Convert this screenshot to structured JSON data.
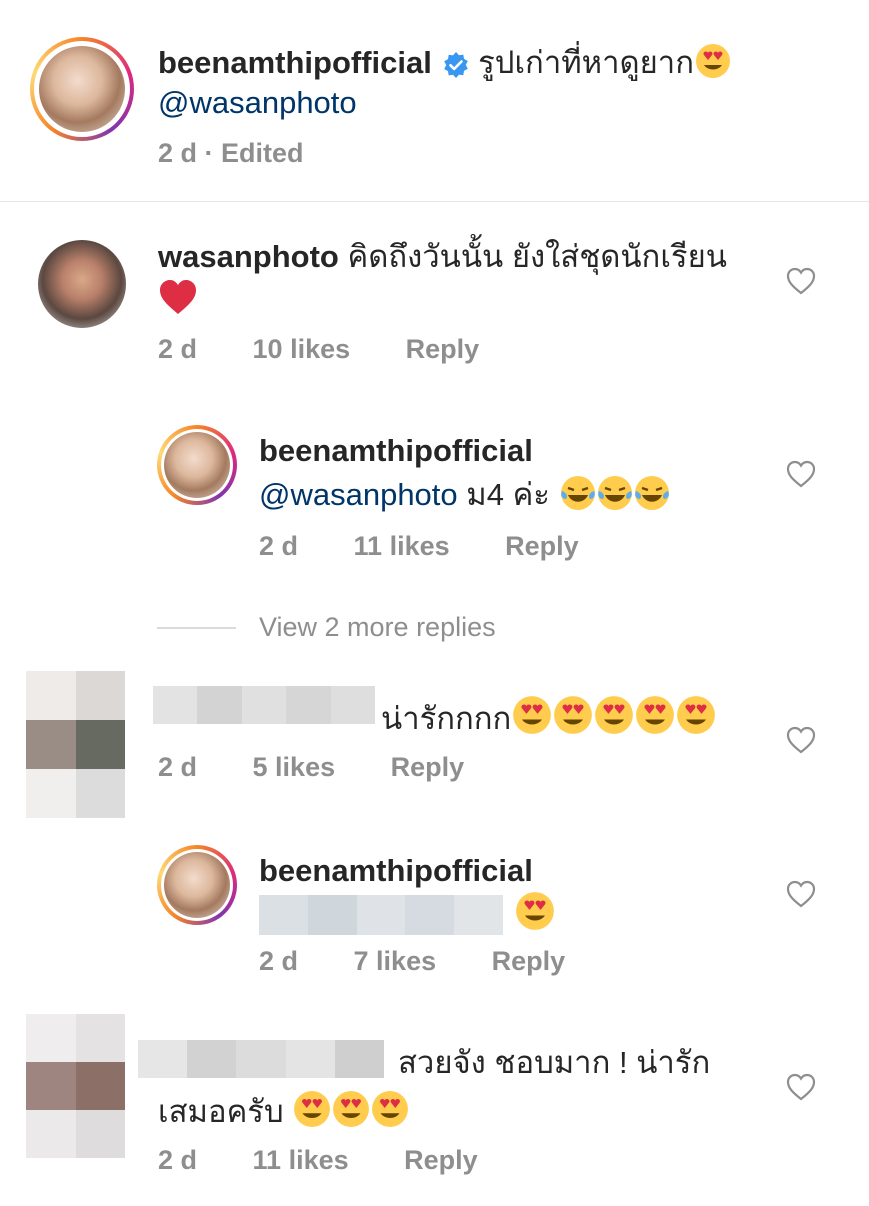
{
  "post": {
    "username": "beenamthipofficial",
    "caption": "รูปเก่าที่หาดูยาก",
    "mention": "@wasanphoto",
    "time": "2 d",
    "edited": "Edited"
  },
  "comments": [
    {
      "username": "wasanphoto",
      "text_line1": "คิดถึงวันนั้น ยังใส่ชุดนักเรียน",
      "time": "2 d",
      "likes": "10 likes",
      "reply": "Reply"
    },
    {
      "username": "beenamthipofficial",
      "mention": "@wasanphoto",
      "text": "ม4 ค่ะ",
      "time": "2 d",
      "likes": "11 likes",
      "reply": "Reply"
    },
    {
      "view_more": "View 2 more replies"
    },
    {
      "text": "น่ารักกกก",
      "time": "2 d",
      "likes": "5 likes",
      "reply": "Reply"
    },
    {
      "username": "beenamthipofficial",
      "time": "2 d",
      "likes": "7 likes",
      "reply": "Reply"
    },
    {
      "text_line1": "สวยจัง ชอบมาก ! น่ารัก",
      "text_line2": "เสมอครับ",
      "time": "2 d",
      "likes": "11 likes",
      "reply": "Reply"
    }
  ],
  "colors": {
    "mention": "#003569",
    "meta": "#8e8e8e",
    "heart": "#ed4956",
    "verified": "#3897f0"
  }
}
